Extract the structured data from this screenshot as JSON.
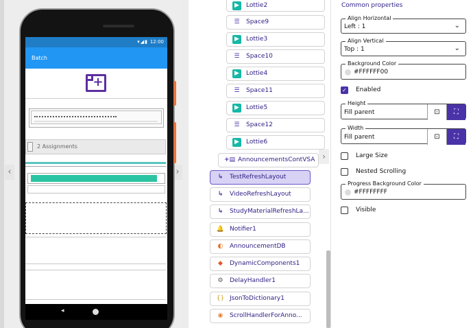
{
  "viewer": {
    "scroll_left": "‹",
    "scroll_right": "›",
    "status_time": "12:00",
    "status_icons": "▾◢▮",
    "app_title": "Batch",
    "add_icon_glyph": "+",
    "assignments_text": "2 Assignments",
    "progress_fraction": 0.955,
    "nav_back": "◂"
  },
  "tree": {
    "collapse_glyph": "›",
    "items": [
      {
        "label": "Lottie2",
        "icon": "lottie-icon",
        "glyph": "▶"
      },
      {
        "label": "Space9",
        "icon": "space-icon",
        "glyph": "☰"
      },
      {
        "label": "Lottie3",
        "icon": "lottie-icon",
        "glyph": "▶"
      },
      {
        "label": "Space10",
        "icon": "space-icon",
        "glyph": "☰"
      },
      {
        "label": "Lottie4",
        "icon": "lottie-icon",
        "glyph": "▶"
      },
      {
        "label": "Space11",
        "icon": "space-icon",
        "glyph": "☰"
      },
      {
        "label": "Lottie5",
        "icon": "lottie-icon",
        "glyph": "▶"
      },
      {
        "label": "Space12",
        "icon": "space-icon",
        "glyph": "☰"
      },
      {
        "label": "Lottie6",
        "icon": "lottie-icon",
        "glyph": "▶"
      },
      {
        "label": "AnnouncementsContVSA",
        "icon": "vertical-scroll-arrangement-icon",
        "glyph": "+▤"
      },
      {
        "label": "TestRefreshLayout",
        "icon": "refresh-layout-icon",
        "glyph": "↳"
      },
      {
        "label": "VideoRefreshLayout",
        "icon": "refresh-layout-icon",
        "glyph": "↳"
      },
      {
        "label": "StudyMaterialRefreshLa...",
        "icon": "refresh-layout-icon",
        "glyph": "↳"
      },
      {
        "label": "Notifier1",
        "icon": "bell-icon",
        "glyph": "🔔"
      },
      {
        "label": "AnnouncementDB",
        "icon": "database-icon",
        "glyph": "◐"
      },
      {
        "label": "DynamicComponents1",
        "icon": "dynamic-components-icon",
        "glyph": "◆"
      },
      {
        "label": "DelayHandler1",
        "icon": "delay-handler-icon",
        "glyph": "⚙"
      },
      {
        "label": "JsonToDictionary1",
        "icon": "json-icon",
        "glyph": "{}"
      },
      {
        "label": "ScrollHandlerForAnno...",
        "icon": "scroll-handler-icon",
        "glyph": "◉"
      }
    ]
  },
  "props": {
    "title": "Common properties",
    "align_horizontal": {
      "label": "Align Horizontal",
      "value": "Left : 1",
      "chev": "⌄"
    },
    "align_vertical": {
      "label": "Align Vertical",
      "value": "Top : 1",
      "chev": "⌄"
    },
    "background_color": {
      "label": "Background Color",
      "value": "#FFFFFF00"
    },
    "enabled": {
      "label": "Enabled",
      "checked": true,
      "mark": "✓"
    },
    "height": {
      "label": "Height",
      "value": "Fill parent",
      "focus_glyph": "⊡",
      "full_glyph": "⛶"
    },
    "width": {
      "label": "Width",
      "value": "Fill parent",
      "focus_glyph": "⊡",
      "full_glyph": "⛶"
    },
    "large_size": {
      "label": "Large Size",
      "checked": false
    },
    "nested_scrolling": {
      "label": "Nested Scrolling",
      "checked": false
    },
    "progress_background_color": {
      "label": "Progress Background Color",
      "value": "#FFFFFFFF"
    },
    "visible": {
      "label": "Visible",
      "checked": false
    }
  },
  "colors": {
    "accent": "#4a32a8",
    "appbar": "#2196f3",
    "selected_node": "#d8d2f5",
    "progress": "#2bc4a3"
  }
}
